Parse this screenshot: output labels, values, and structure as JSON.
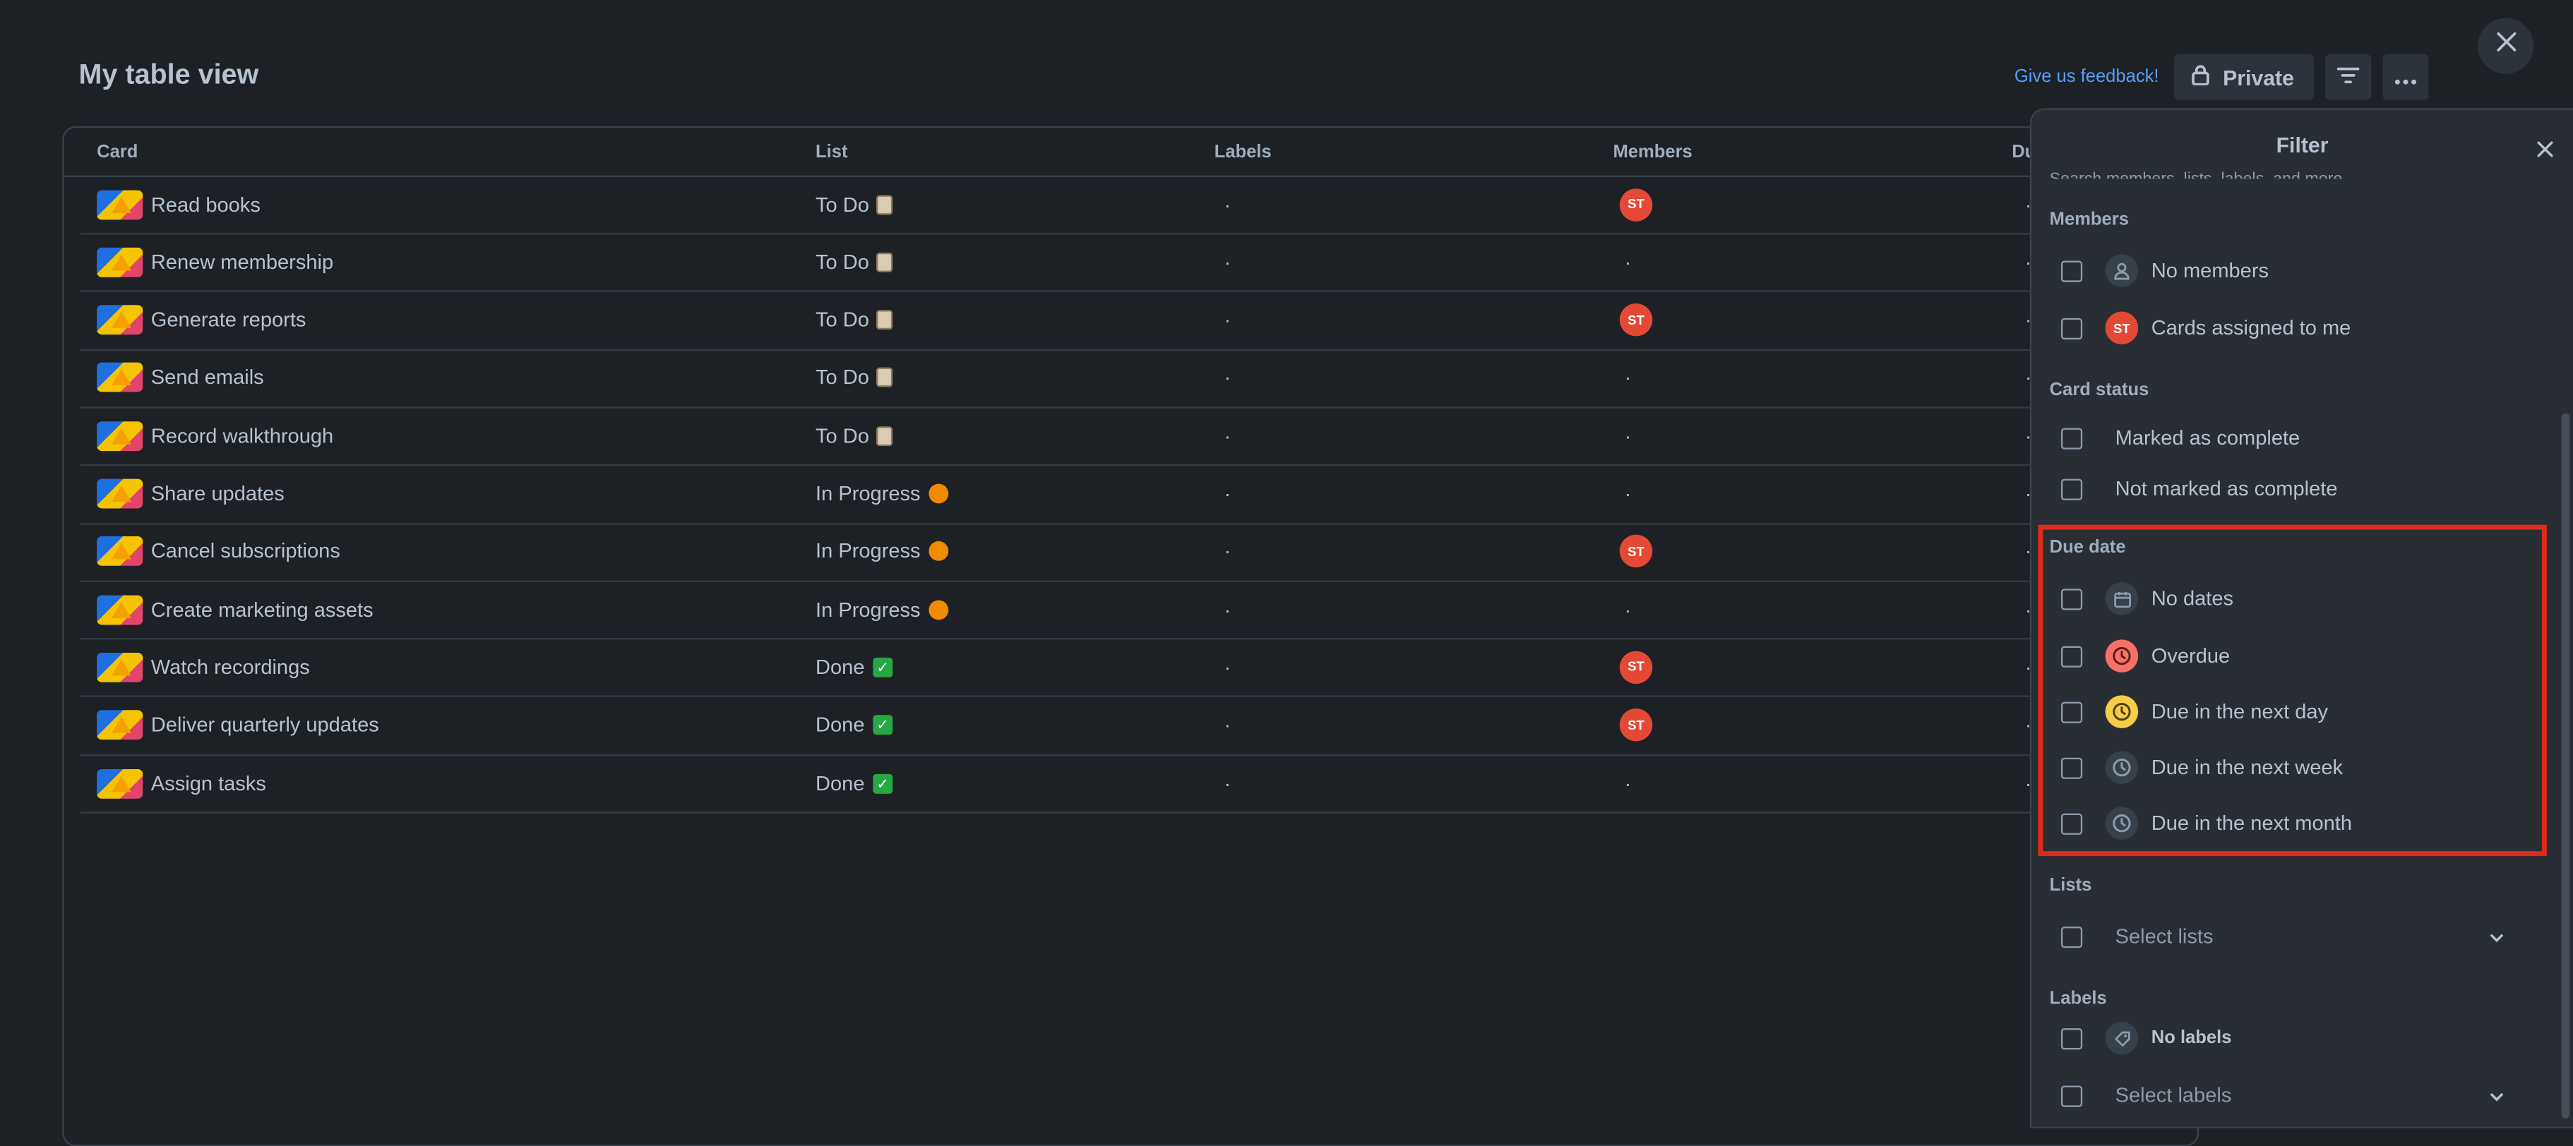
{
  "page_title": "My table view",
  "topbar": {
    "feedback": "Give us feedback!",
    "private_label": "Private"
  },
  "table": {
    "headers": [
      "Card",
      "List",
      "Labels",
      "Members",
      "Du"
    ],
    "rows": [
      {
        "card": "Read books",
        "list": "To Do",
        "list_emoji": "clipboard",
        "labels": "·",
        "member": "ST"
      },
      {
        "card": "Renew membership",
        "list": "To Do",
        "list_emoji": "clipboard",
        "labels": "·",
        "member": "·"
      },
      {
        "card": "Generate reports",
        "list": "To Do",
        "list_emoji": "clipboard",
        "labels": "·",
        "member": "ST"
      },
      {
        "card": "Send emails",
        "list": "To Do",
        "list_emoji": "clipboard",
        "labels": "·",
        "member": "·"
      },
      {
        "card": "Record walkthrough",
        "list": "To Do",
        "list_emoji": "clipboard",
        "labels": "·",
        "member": "·"
      },
      {
        "card": "Share updates",
        "list": "In Progress",
        "list_emoji": "orange-circle",
        "labels": "·",
        "member": "·"
      },
      {
        "card": "Cancel subscriptions",
        "list": "In Progress",
        "list_emoji": "orange-circle",
        "labels": "·",
        "member": "ST"
      },
      {
        "card": "Create marketing assets",
        "list": "In Progress",
        "list_emoji": "orange-circle",
        "labels": "·",
        "member": "·"
      },
      {
        "card": "Watch recordings",
        "list": "Done",
        "list_emoji": "check-mark",
        "labels": "·",
        "member": "ST"
      },
      {
        "card": "Deliver quarterly updates",
        "list": "Done",
        "list_emoji": "check-mark",
        "labels": "·",
        "member": "ST"
      },
      {
        "card": "Assign tasks",
        "list": "Done",
        "list_emoji": "check-mark",
        "labels": "·",
        "member": "·"
      }
    ],
    "due_dots": "·"
  },
  "filter": {
    "title": "Filter",
    "hint": "Search members, lists, labels, and more.",
    "members": {
      "heading": "Members",
      "no_members": "No members",
      "assigned_to_me": "Cards assigned to me",
      "avatar": "ST"
    },
    "card_status": {
      "heading": "Card status",
      "complete": "Marked as complete",
      "not_complete": "Not marked as complete"
    },
    "due_date": {
      "heading": "Due date",
      "no_dates": "No dates",
      "overdue": "Overdue",
      "next_day": "Due in the next day",
      "next_week": "Due in the next week",
      "next_month": "Due in the next month"
    },
    "lists": {
      "heading": "Lists",
      "placeholder": "Select lists"
    },
    "labels": {
      "heading": "Labels",
      "no_labels": "No labels",
      "placeholder": "Select labels"
    }
  },
  "colors": {
    "background": "#1d2125",
    "avatar": "#e34935",
    "highlight_box": "#e02a1b",
    "link": "#579dff"
  }
}
